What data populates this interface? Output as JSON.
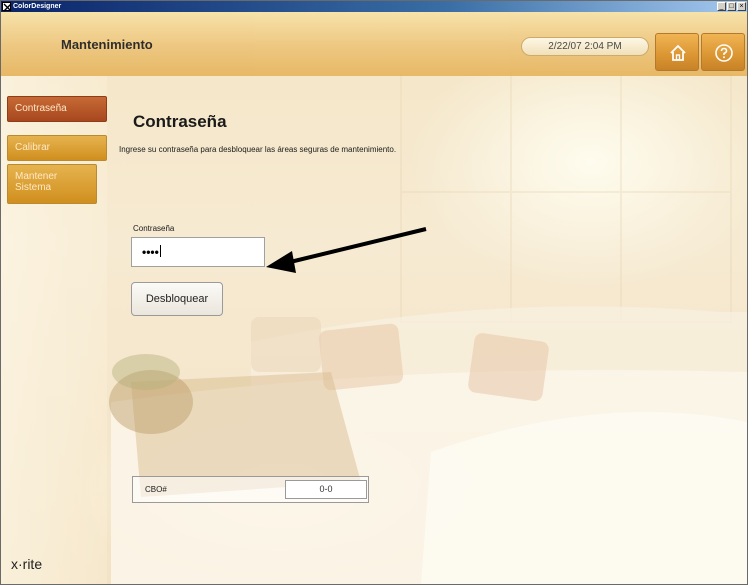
{
  "window": {
    "title": "ColorDesigner",
    "icon": "app-icon",
    "controls": [
      "minimize",
      "maximize",
      "close"
    ]
  },
  "header": {
    "title": "Mantenimiento",
    "datetime": "2/22/07 2:04 PM",
    "home_icon": "home-icon",
    "help_icon": "help-icon"
  },
  "sidebar": {
    "items": [
      {
        "label": "Contraseña",
        "state": "active"
      },
      {
        "label": "Calibrar",
        "state": "normal"
      },
      {
        "label": "Mantener Sistema",
        "state": "normal"
      }
    ],
    "logo_text": "x·rite"
  },
  "main": {
    "title": "Contraseña",
    "instructions": "Ingrese su contraseña para desbloquear las áreas seguras de mantenimiento.",
    "password_label": "Contraseña",
    "password_value": "••••",
    "unlock_label": "Desbloquear",
    "cbo_label": "CBO#",
    "cbo_value": "0-0"
  },
  "colors": {
    "header": "#edc47a",
    "nav_active": "#b04f25",
    "nav_normal": "#d99a2b",
    "header_button": "#d98f26"
  }
}
